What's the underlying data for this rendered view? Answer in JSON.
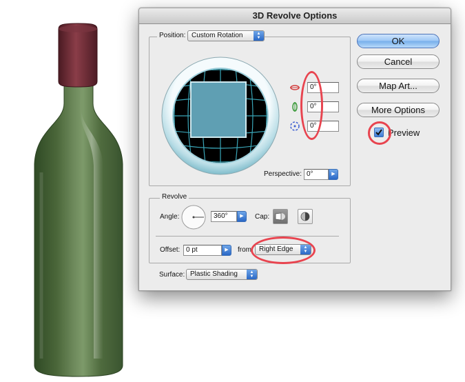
{
  "dialog": {
    "title": "3D Revolve Options",
    "position": {
      "label": "Position:",
      "preset": "Custom Rotation",
      "rotation_x": "0°",
      "rotation_y": "0°",
      "rotation_z": "0°",
      "perspective_label": "Perspective:",
      "perspective_value": "0°"
    },
    "revolve": {
      "legend": "Revolve",
      "angle_label": "Angle:",
      "angle_value": "360°",
      "cap_label": "Cap:",
      "offset_label": "Offset:",
      "offset_value": "0 pt",
      "from_label": "from",
      "from_value": "Right Edge"
    },
    "surface": {
      "label": "Surface:",
      "value": "Plastic Shading"
    },
    "buttons": {
      "ok": "OK",
      "cancel": "Cancel",
      "map_art": "Map Art...",
      "more_options": "More Options"
    },
    "preview": {
      "label": "Preview",
      "checked": true
    }
  },
  "colors": {
    "annotation": "#e8444f",
    "bottle_glass": "#4f6a3e",
    "bottle_cap": "#6b2a34",
    "cube_face": "#5f9fb3"
  },
  "icons": [
    "rotate-x-icon",
    "rotate-y-icon",
    "rotate-z-icon",
    "cap-on-icon",
    "cap-off-icon",
    "checkbox-check-icon"
  ]
}
